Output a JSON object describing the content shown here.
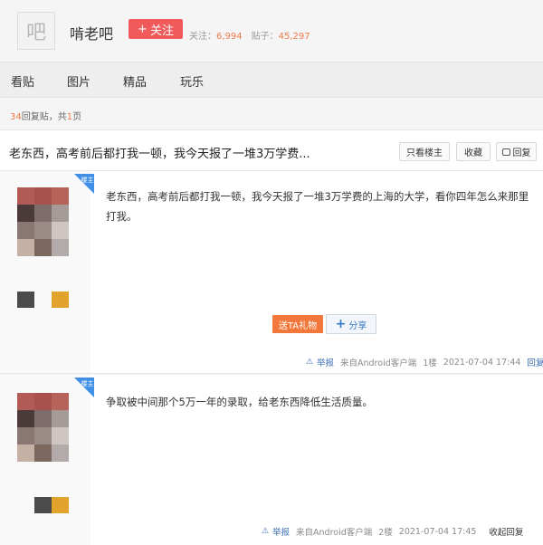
{
  "forum": {
    "logo_char": "吧",
    "name": "啃老吧",
    "follow_label": "关注",
    "followers_label": "关注：",
    "followers": "6,994",
    "posts_label": "贴子：",
    "posts": "45,297"
  },
  "nav": {
    "items": [
      "看贴",
      "图片",
      "精品",
      "玩乐"
    ]
  },
  "thread": {
    "reply_count": "34",
    "reply_suffix": "回复贴，共",
    "page_count": "1",
    "page_suffix": "页",
    "title": "老东西，高考前后都打我一顿，我今天报了一堆3万学费...",
    "only_op_label": "只看楼主",
    "favorite_label": "收藏",
    "reply_label": "回复"
  },
  "posts": [
    {
      "badge": "楼主",
      "content_line1": "老东西，高考前后都打我一顿，我今天报了一堆3万学费的上海的大学，看你四年怎么来那里",
      "content_line2": "打我。",
      "gift_label": "送TA礼物",
      "share_label": "分享",
      "report_label": "举报",
      "source": "来自Android客户端",
      "floor": "1楼",
      "time": "2021-07-04 17:44",
      "reply_label": "回复"
    },
    {
      "badge": "楼主",
      "content_line1": "争取被中间那个5万一年的录取，给老东西降低生活质量。",
      "report_label": "举报",
      "source": "来自Android客户端",
      "floor": "2楼",
      "time": "2021-07-04 17:45",
      "reply_label": "收起回复"
    }
  ],
  "colors": {
    "accent_red": "#f05a5a",
    "number_orange": "#ee7b4a",
    "badge_blue": "#3f8fe6",
    "link_blue": "#3b6fb6",
    "gift_orange": "#f2773a"
  },
  "icons": {
    "follow": "plus-icon",
    "reply": "speech-bubble-icon",
    "share": "plus-icon",
    "report": "warning-icon"
  }
}
